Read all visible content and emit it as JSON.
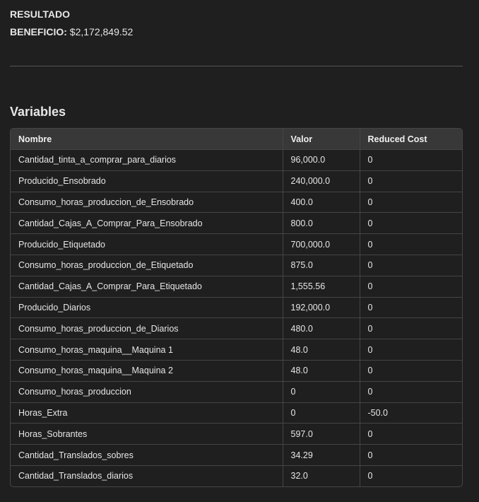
{
  "result": {
    "title": "RESULTADO",
    "benefit_label": "BENEFICIO:",
    "benefit_value": "$2,172,849.52"
  },
  "variables": {
    "title": "Variables",
    "columns": [
      "Nombre",
      "Valor",
      "Reduced Cost"
    ],
    "rows": [
      [
        "Cantidad_tinta_a_comprar_para_diarios",
        "96,000.0",
        "0"
      ],
      [
        "Producido_Ensobrado",
        "240,000.0",
        "0"
      ],
      [
        "Consumo_horas_produccion_de_Ensobrado",
        "400.0",
        "0"
      ],
      [
        "Cantidad_Cajas_A_Comprar_Para_Ensobrado",
        "800.0",
        "0"
      ],
      [
        "Producido_Etiquetado",
        "700,000.0",
        "0"
      ],
      [
        "Consumo_horas_produccion_de_Etiquetado",
        "875.0",
        "0"
      ],
      [
        "Cantidad_Cajas_A_Comprar_Para_Etiquetado",
        "1,555.56",
        "0"
      ],
      [
        "Producido_Diarios",
        "192,000.0",
        "0"
      ],
      [
        "Consumo_horas_produccion_de_Diarios",
        "480.0",
        "0"
      ],
      [
        "Consumo_horas_maquina__Maquina 1",
        "48.0",
        "0"
      ],
      [
        "Consumo_horas_maquina__Maquina 2",
        "48.0",
        "0"
      ],
      [
        "Consumo_horas_produccion",
        "0",
        "0"
      ],
      [
        "Horas_Extra",
        "0",
        "-50.0"
      ],
      [
        "Horas_Sobrantes",
        "597.0",
        "0"
      ],
      [
        "Cantidad_Translados_sobres",
        "34.29",
        "0"
      ],
      [
        "Cantidad_Translados_diarios",
        "32.0",
        "0"
      ]
    ]
  }
}
